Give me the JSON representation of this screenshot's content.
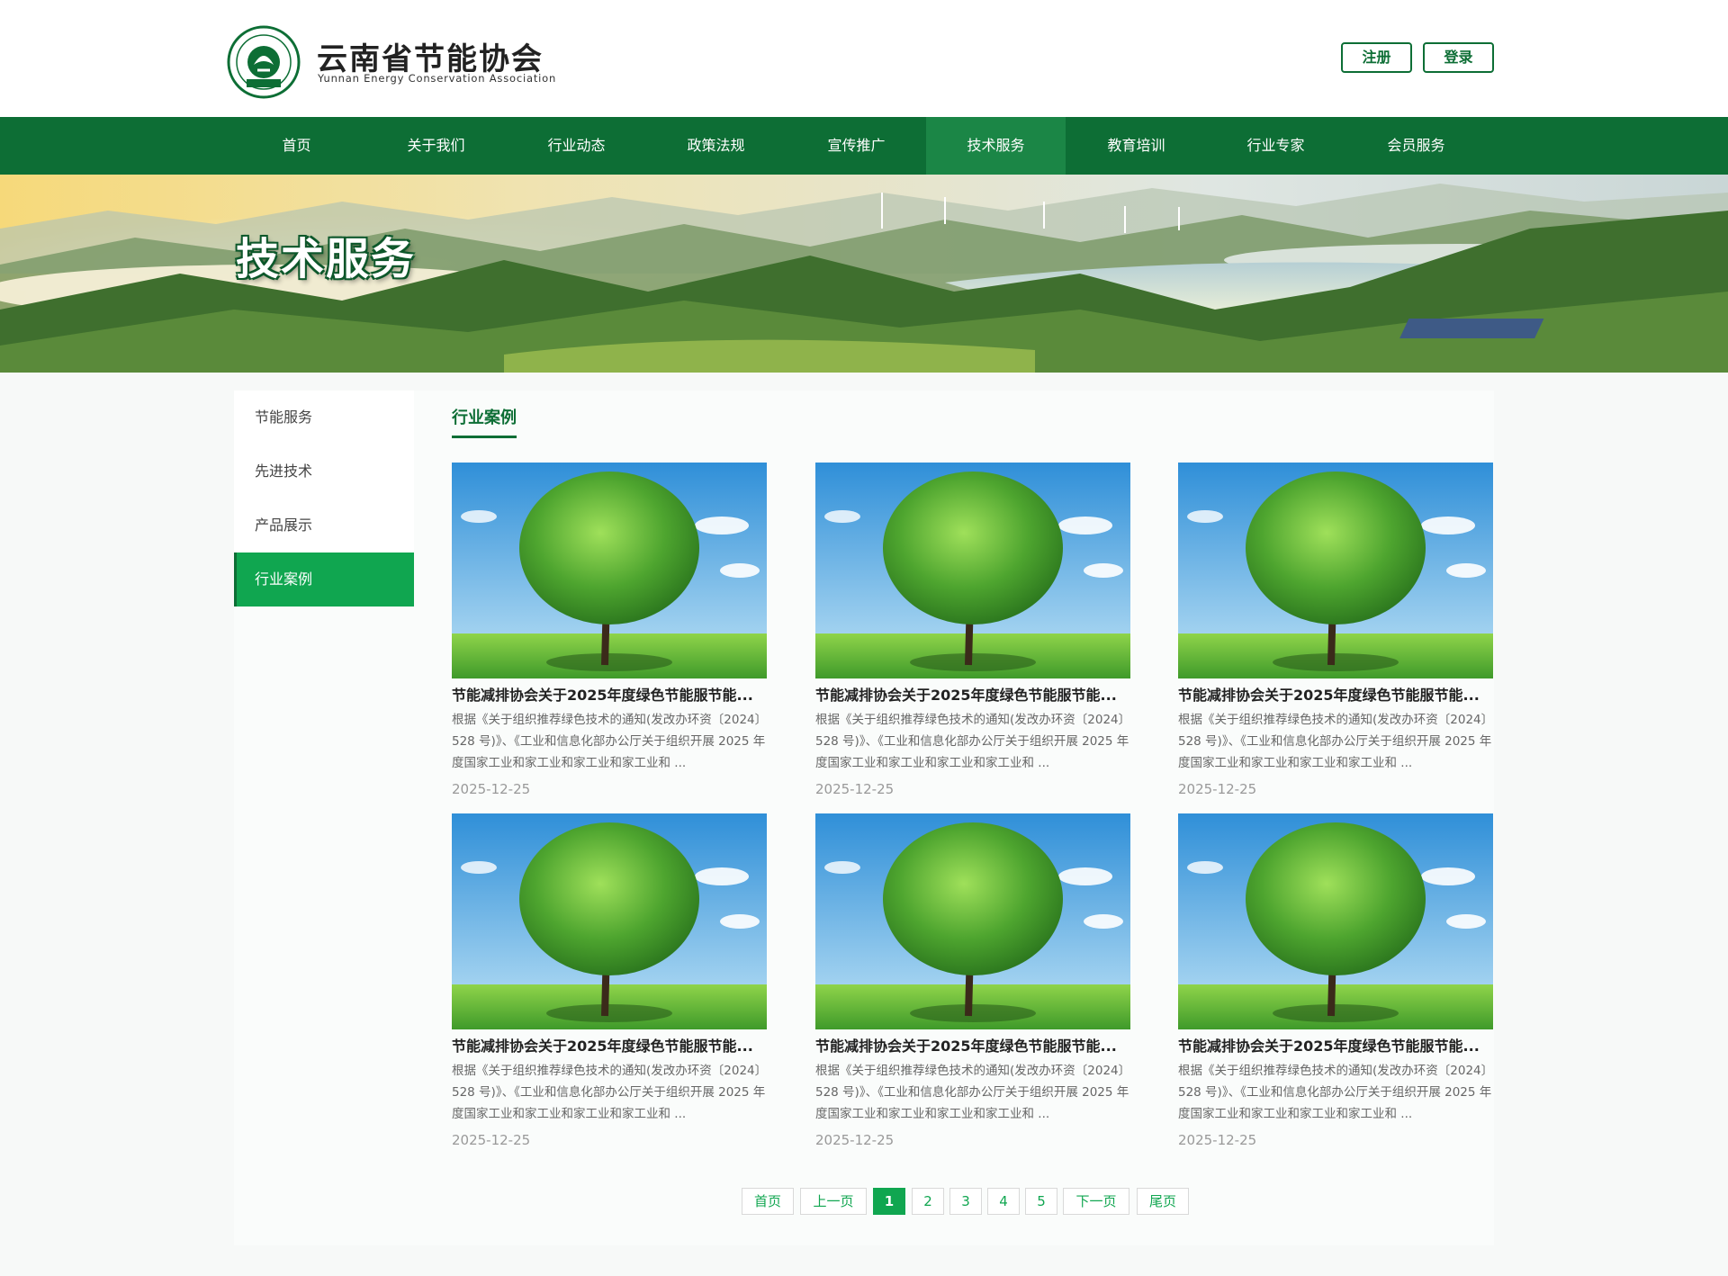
{
  "header": {
    "logo_title": "云南省节能协会",
    "logo_subtitle": "Yunnan Energy Conservation Association",
    "register_label": "注册",
    "login_label": "登录"
  },
  "nav": {
    "items": [
      {
        "label": "首页"
      },
      {
        "label": "关于我们"
      },
      {
        "label": "行业动态"
      },
      {
        "label": "政策法规"
      },
      {
        "label": "宣传推广"
      },
      {
        "label": "技术服务"
      },
      {
        "label": "教育培训"
      },
      {
        "label": "行业专家"
      },
      {
        "label": "会员服务"
      }
    ],
    "active": "技术服务"
  },
  "banner": {
    "title": "技术服务"
  },
  "sidebar": {
    "items": [
      {
        "label": "节能服务"
      },
      {
        "label": "先进技术"
      },
      {
        "label": "产品展示"
      },
      {
        "label": "行业案例"
      }
    ],
    "active": "行业案例"
  },
  "section": {
    "title": "行业案例"
  },
  "cards": [
    {
      "title": "节能减排协会关于2025年度绿色节能服节能...",
      "desc": "根据《关于组织推荐绿色技术的通知(发改办环资〔2024〕528 号)》、《工业和信息化部办公厅关于组织开展 2025 年度国家工业和家工业和家工业和家工业和 ...",
      "date": "2025-12-25"
    },
    {
      "title": "节能减排协会关于2025年度绿色节能服节能...",
      "desc": "根据《关于组织推荐绿色技术的通知(发改办环资〔2024〕528 号)》、《工业和信息化部办公厅关于组织开展 2025 年度国家工业和家工业和家工业和家工业和 ...",
      "date": "2025-12-25"
    },
    {
      "title": "节能减排协会关于2025年度绿色节能服节能...",
      "desc": "根据《关于组织推荐绿色技术的通知(发改办环资〔2024〕528 号)》、《工业和信息化部办公厅关于组织开展 2025 年度国家工业和家工业和家工业和家工业和 ...",
      "date": "2025-12-25"
    },
    {
      "title": "节能减排协会关于2025年度绿色节能服节能...",
      "desc": "根据《关于组织推荐绿色技术的通知(发改办环资〔2024〕528 号)》、《工业和信息化部办公厅关于组织开展 2025 年度国家工业和家工业和家工业和家工业和 ...",
      "date": "2025-12-25"
    },
    {
      "title": "节能减排协会关于2025年度绿色节能服节能...",
      "desc": "根据《关于组织推荐绿色技术的通知(发改办环资〔2024〕528 号)》、《工业和信息化部办公厅关于组织开展 2025 年度国家工业和家工业和家工业和家工业和 ...",
      "date": "2025-12-25"
    },
    {
      "title": "节能减排协会关于2025年度绿色节能服节能...",
      "desc": "根据《关于组织推荐绿色技术的通知(发改办环资〔2024〕528 号)》、《工业和信息化部办公厅关于组织开展 2025 年度国家工业和家工业和家工业和家工业和 ...",
      "date": "2025-12-25"
    }
  ],
  "pagination": {
    "first": "首页",
    "prev": "上一页",
    "pages": [
      "1",
      "2",
      "3",
      "4",
      "5"
    ],
    "current": "1",
    "next": "下一页",
    "last": "尾页"
  },
  "colors": {
    "brand_green": "#0d6e35",
    "accent_green": "#10a650"
  }
}
